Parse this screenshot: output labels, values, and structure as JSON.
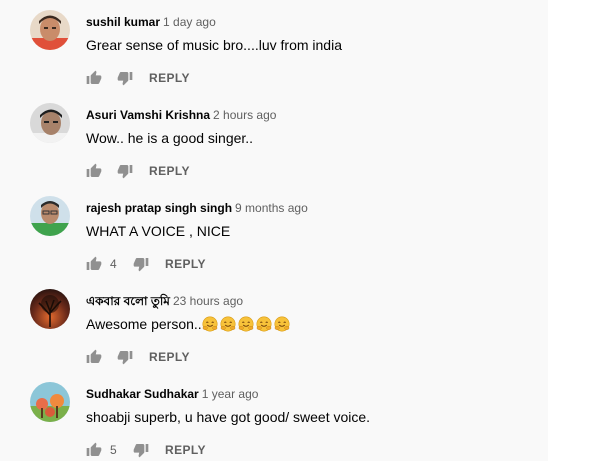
{
  "colors": {
    "author": "#030303",
    "meta": "#606060",
    "text": "#030303",
    "icon": "#909090"
  },
  "comments": [
    {
      "author": "sushil kumar",
      "time": "1 day ago",
      "text": "Grear sense of music bro....luv from india",
      "likes": "",
      "reply_label": "REPLY",
      "emojis": 0
    },
    {
      "author": "Asuri Vamshi Krishna",
      "time": "2 hours ago",
      "text": "Wow.. he is a good singer..",
      "likes": "",
      "reply_label": "REPLY",
      "emojis": 0
    },
    {
      "author": "rajesh pratap singh singh",
      "time": "9 months ago",
      "text": "WHAT A VOICE , NICE",
      "likes": "4",
      "reply_label": "REPLY",
      "emojis": 0
    },
    {
      "author": "একবার বলো তুমি",
      "time": "23 hours ago",
      "text": "Awesome person..",
      "likes": "",
      "reply_label": "REPLY",
      "emojis": 5
    },
    {
      "author": "Sudhakar Sudhakar",
      "time": "1 year ago",
      "text": "shoabji superb, u have got good/ sweet voice.",
      "likes": "5",
      "reply_label": "REPLY",
      "emojis": 0
    }
  ]
}
